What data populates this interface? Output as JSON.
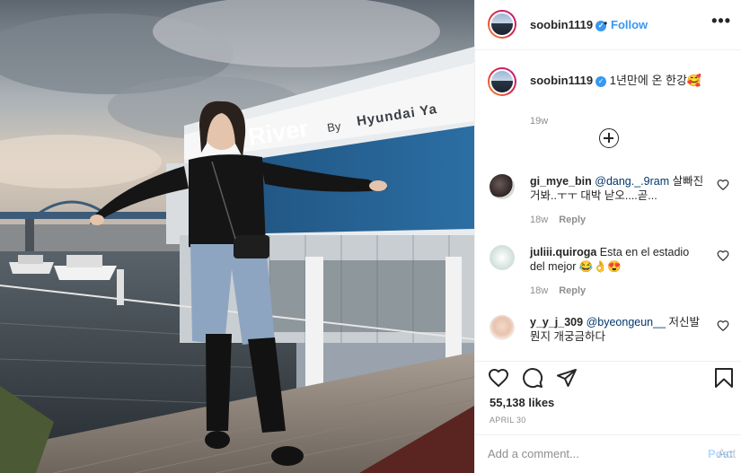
{
  "photo": {
    "alt": "Photo by soobin1119",
    "sign_main": "River",
    "sign_by": "By",
    "sign_brand": "Hyundai Ya"
  },
  "post": {
    "username": "soobin1119",
    "separator": "•",
    "follow_label": "Follow",
    "more_label": "•••",
    "caption": {
      "username": "soobin1119",
      "text": "1년만에 온 한강🥰",
      "time": "19w"
    },
    "comments": [
      {
        "username": "gi_mye_bin",
        "mention": "@dang._.9ram",
        "text": " 살빠진거봐..ㅜㅜ 대박 낟오....곧...",
        "time": "18w",
        "reply_label": "Reply"
      },
      {
        "username": "juliii.quiroga",
        "mention": "",
        "text": " Esta en el estadio del mejor 😂👌😍",
        "time": "18w",
        "reply_label": "Reply"
      },
      {
        "username": "y_y_j_309",
        "mention": "@byeongeun__",
        "text": " 저신발 뭔지 개궁금하다",
        "time": "",
        "reply_label": ""
      }
    ],
    "likes": "55,138 likes",
    "date": "APRIL 30",
    "comment_placeholder": "Add a comment...",
    "post_label": "Post",
    "watermark": "Act"
  },
  "colors": {
    "accent": "#3897f0",
    "text": "#262626",
    "muted": "#8e8e8e",
    "border": "#efefef",
    "post_disabled": "#b3dbff"
  },
  "icons": [
    "verified-badge-icon",
    "more-options-icon",
    "load-more-comments-icon",
    "heart-icon",
    "comment-icon",
    "share-icon",
    "save-bookmark-icon"
  ]
}
